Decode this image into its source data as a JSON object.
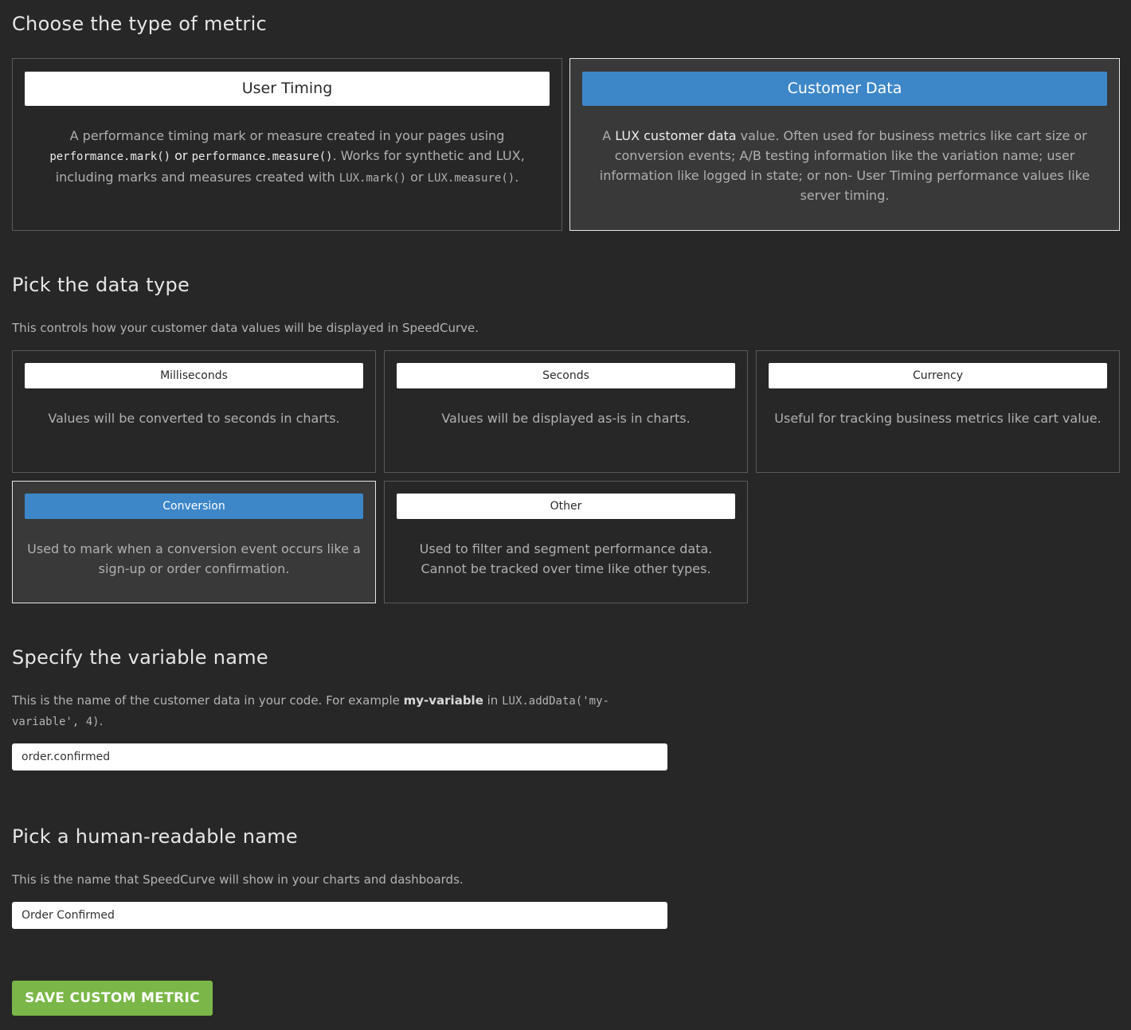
{
  "metric_type": {
    "title": "Choose the type of metric",
    "user_timing": {
      "label": "User Timing",
      "text_1": "A performance timing mark or measure created in your pages using",
      "code_1": "performance.mark()",
      "text_2": " or ",
      "code_2": "performance.measure()",
      "text_3": ". Works for synthetic and LUX, including marks and measures created with ",
      "code_3": "LUX.mark()",
      "text_4": " or ",
      "code_4": "LUX.measure()",
      "text_5": "."
    },
    "customer_data": {
      "label": "Customer Data",
      "text_1": "A ",
      "strong": "LUX customer data",
      "text_2": " value. Often used for business metrics like cart size or conversion events; A/B testing information like the variation name; user information like logged in state; or non- User Timing performance values like server timing.",
      "selected": true
    }
  },
  "data_type": {
    "title": "Pick the data type",
    "description": "This controls how your customer data values will be displayed in SpeedCurve.",
    "options": [
      {
        "label": "Milliseconds",
        "text": "Values will be converted to seconds in charts."
      },
      {
        "label": "Seconds",
        "text": "Values will be displayed as-is in charts."
      },
      {
        "label": "Currency",
        "text": "Useful for tracking business metrics like cart value."
      },
      {
        "label": "Conversion",
        "text": "Used to mark when a conversion event occurs like a sign-up or order confirmation.",
        "selected": true
      },
      {
        "label": "Other",
        "text": "Used to filter and segment performance data. Cannot be tracked over time like other types."
      }
    ]
  },
  "variable_name": {
    "title": "Specify the variable name",
    "desc_1": "This is the name of the customer data in your code. For example ",
    "desc_strong": "my-variable",
    "desc_2": " in ",
    "desc_code": "LUX.addData('my-variable', 4)",
    "desc_3": ".",
    "value": "order.confirmed"
  },
  "human_name": {
    "title": "Pick a human-readable name",
    "description": "This is the name that SpeedCurve will show in your charts and dashboards.",
    "value": "Order Confirmed"
  },
  "save_button": "SAVE CUSTOM METRIC",
  "colors": {
    "background": "#272727",
    "selected_accent": "#3d87c8",
    "save_green": "#7ab748"
  }
}
